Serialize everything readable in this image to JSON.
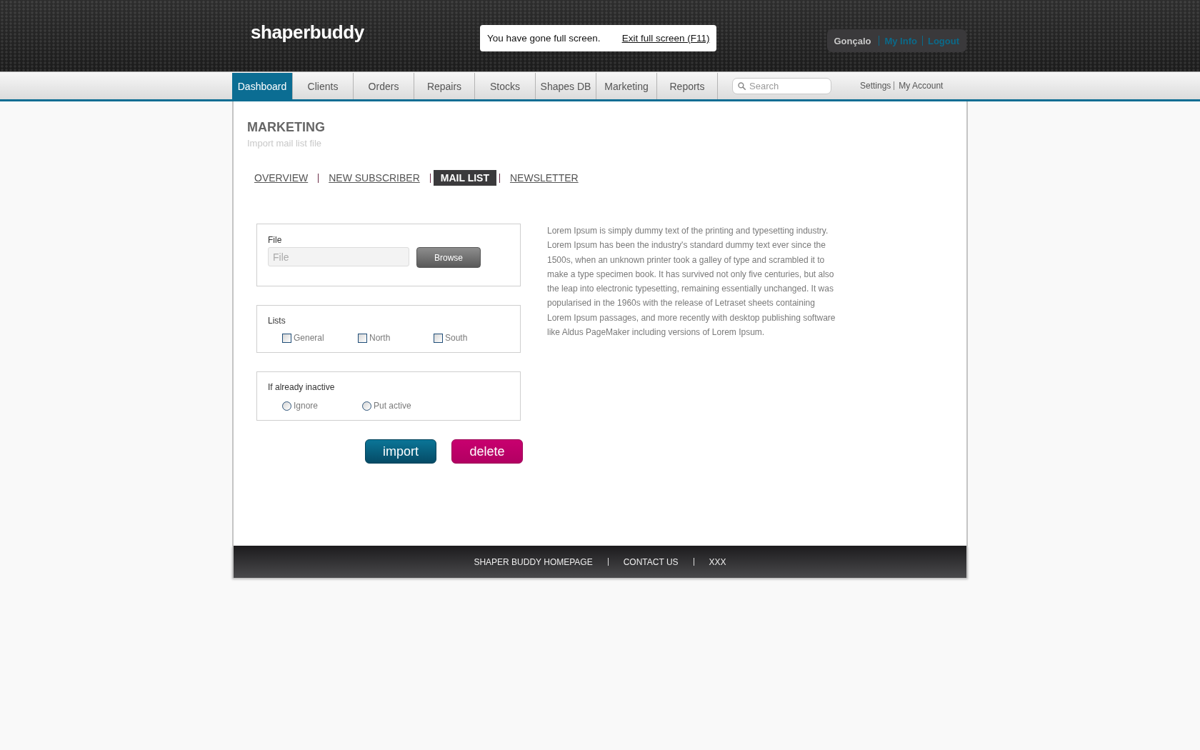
{
  "header": {
    "logo": "shaperbuddy",
    "fullscreen_notice": {
      "message": "You have gone full screen.",
      "link": "Exit full screen (F11)"
    },
    "user": {
      "name": "Gonçalo",
      "links": [
        "My Info",
        "Logout"
      ]
    }
  },
  "nav": {
    "tabs": [
      {
        "label": "Dashboard",
        "selected": true
      },
      {
        "label": "Clients",
        "selected": false
      },
      {
        "label": "Orders",
        "selected": false
      },
      {
        "label": "Repairs",
        "selected": false
      },
      {
        "label": "Stocks",
        "selected": false
      },
      {
        "label": "Shapes DB",
        "selected": false
      },
      {
        "label": "Marketing",
        "selected": false
      },
      {
        "label": "Reports",
        "selected": false
      }
    ],
    "search": {
      "placeholder": "Search"
    },
    "links": [
      "Settings",
      "My Account"
    ]
  },
  "page": {
    "title": "MARKETING",
    "subtitle": "Import mail list file",
    "subtabs": [
      {
        "label": "OVERVIEW",
        "selected": false
      },
      {
        "label": "NEW SUBSCRIBER",
        "selected": false
      },
      {
        "label": "MAIL LIST",
        "selected": true
      },
      {
        "label": "NEWSLETTER",
        "selected": false
      }
    ]
  },
  "form": {
    "file": {
      "label": "File",
      "placeholder": "File",
      "button": "Browse"
    },
    "lists": {
      "label": "Lists",
      "options": [
        {
          "label": "General",
          "checked": false
        },
        {
          "label": "North",
          "checked": false
        },
        {
          "label": "South",
          "checked": false
        }
      ]
    },
    "inactive": {
      "label": "If already inactive",
      "options": [
        {
          "label": "Ignore",
          "selected": false
        },
        {
          "label": "Put active",
          "selected": false
        }
      ]
    },
    "buttons": [
      {
        "label": "import",
        "kind": "import"
      },
      {
        "label": "delete",
        "kind": "delete"
      }
    ]
  },
  "description_lines": [
    "Lorem Ipsum is simply dummy text of the printing and typesetting industry.",
    "Lorem Ipsum has been the industry's standard dummy text ever since the",
    "1500s, when an unknown printer took a galley of type and scrambled it to",
    "make a type specimen book. It has survived not only five centuries, but also",
    "the leap into electronic typesetting, remaining essentially unchanged. It was",
    "popularised in the 1960s with the release of Letraset sheets containing",
    "Lorem Ipsum passages, and more recently with desktop publishing software",
    "like Aldus PageMaker including versions of Lorem Ipsum."
  ],
  "footer": {
    "links": [
      "SHAPER BUDDY HOMEPAGE",
      "CONTACT US",
      "XXX"
    ]
  }
}
